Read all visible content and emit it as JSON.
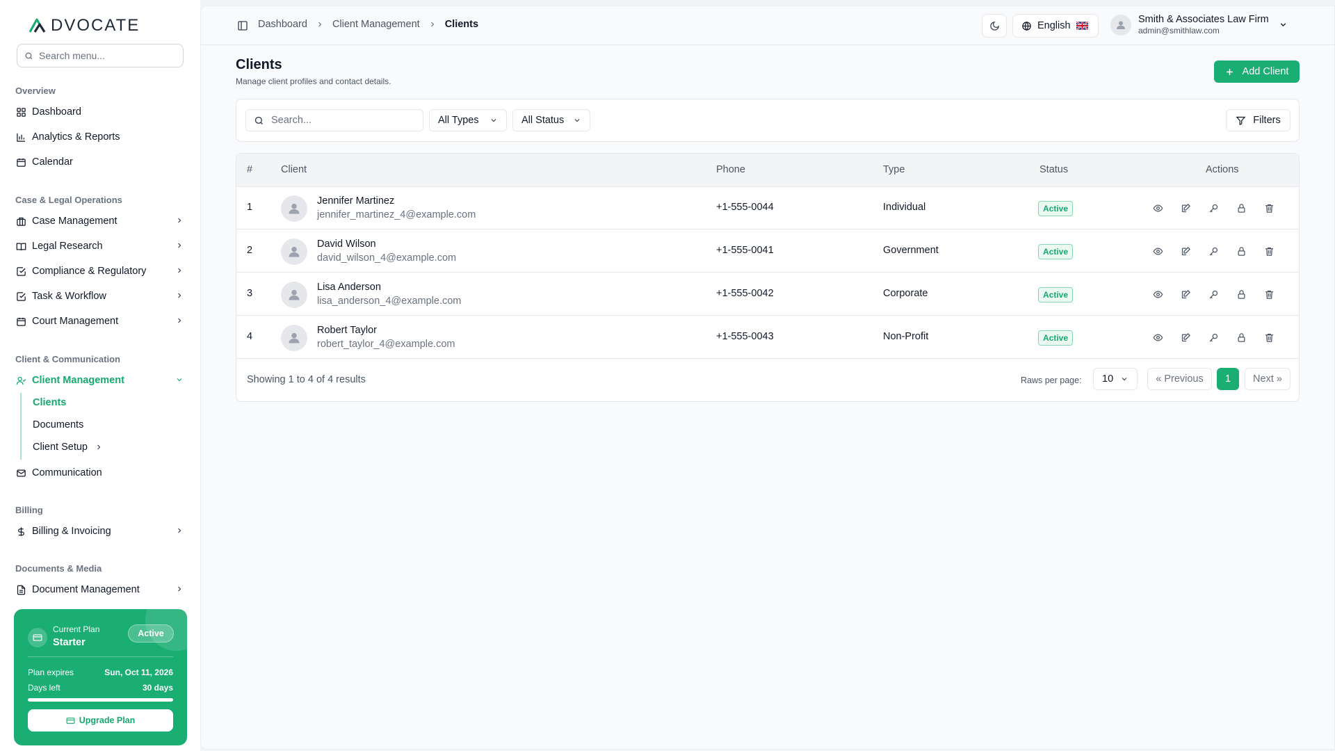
{
  "brand": {
    "logo_text": "DVOCATE",
    "accent": "#1aae73"
  },
  "sidebar": {
    "search_placeholder": "Search menu...",
    "sections": {
      "overview": "Overview",
      "case_legal": "Case & Legal Operations",
      "client_comm": "Client & Communication",
      "billing": "Billing",
      "docs_media": "Documents & Media"
    },
    "items": {
      "dashboard": "Dashboard",
      "analytics": "Analytics & Reports",
      "calendar": "Calendar",
      "case_management": "Case Management",
      "legal_research": "Legal Research",
      "compliance": "Compliance & Regulatory",
      "task_workflow": "Task & Workflow",
      "court_management": "Court Management",
      "client_management": "Client Management",
      "communication": "Communication",
      "billing_invoicing": "Billing & Invoicing",
      "document_management": "Document Management"
    },
    "sub_items": {
      "clients": "Clients",
      "documents": "Documents",
      "client_setup": "Client Setup"
    }
  },
  "plan": {
    "label": "Current Plan",
    "name": "Starter",
    "badge": "Active",
    "expires_label": "Plan expires",
    "expires_value": "Sun, Oct 11, 2026",
    "days_label": "Days left",
    "days_value": "30 days",
    "progress_fraction": 1.0,
    "upgrade_label": "Upgrade Plan"
  },
  "header": {
    "breadcrumbs": [
      "Dashboard",
      "Client Management",
      "Clients"
    ],
    "language": "English",
    "user_name": "Smith & Associates Law Firm",
    "user_email": "admin@smithlaw.com"
  },
  "page": {
    "title": "Clients",
    "subtitle": "Manage client profiles and contact details.",
    "add_button": "Add Client"
  },
  "filters": {
    "search_placeholder": "Search...",
    "type_select": "All Types",
    "status_select": "All Status",
    "filters_button": "Filters"
  },
  "table": {
    "columns": [
      "#",
      "Client",
      "Phone",
      "Type",
      "Status",
      "Actions"
    ],
    "rows": [
      {
        "num": "1",
        "name": "Jennifer Martinez",
        "email": "jennifer_martinez_4@example.com",
        "phone": "+1-555-0044",
        "type": "Individual",
        "status": "Active"
      },
      {
        "num": "2",
        "name": "David Wilson",
        "email": "david_wilson_4@example.com",
        "phone": "+1-555-0041",
        "type": "Government",
        "status": "Active"
      },
      {
        "num": "3",
        "name": "Lisa Anderson",
        "email": "lisa_anderson_4@example.com",
        "phone": "+1-555-0042",
        "type": "Corporate",
        "status": "Active"
      },
      {
        "num": "4",
        "name": "Robert Taylor",
        "email": "robert_taylor_4@example.com",
        "phone": "+1-555-0043",
        "type": "Non-Profit",
        "status": "Active"
      }
    ]
  },
  "pagination": {
    "showing": "Showing 1 to 4 of 4 results",
    "rows_per_page_label": "Raws per page:",
    "rows_per_page": "10",
    "previous": "« Previous",
    "current_page": "1",
    "next": "Next »"
  }
}
